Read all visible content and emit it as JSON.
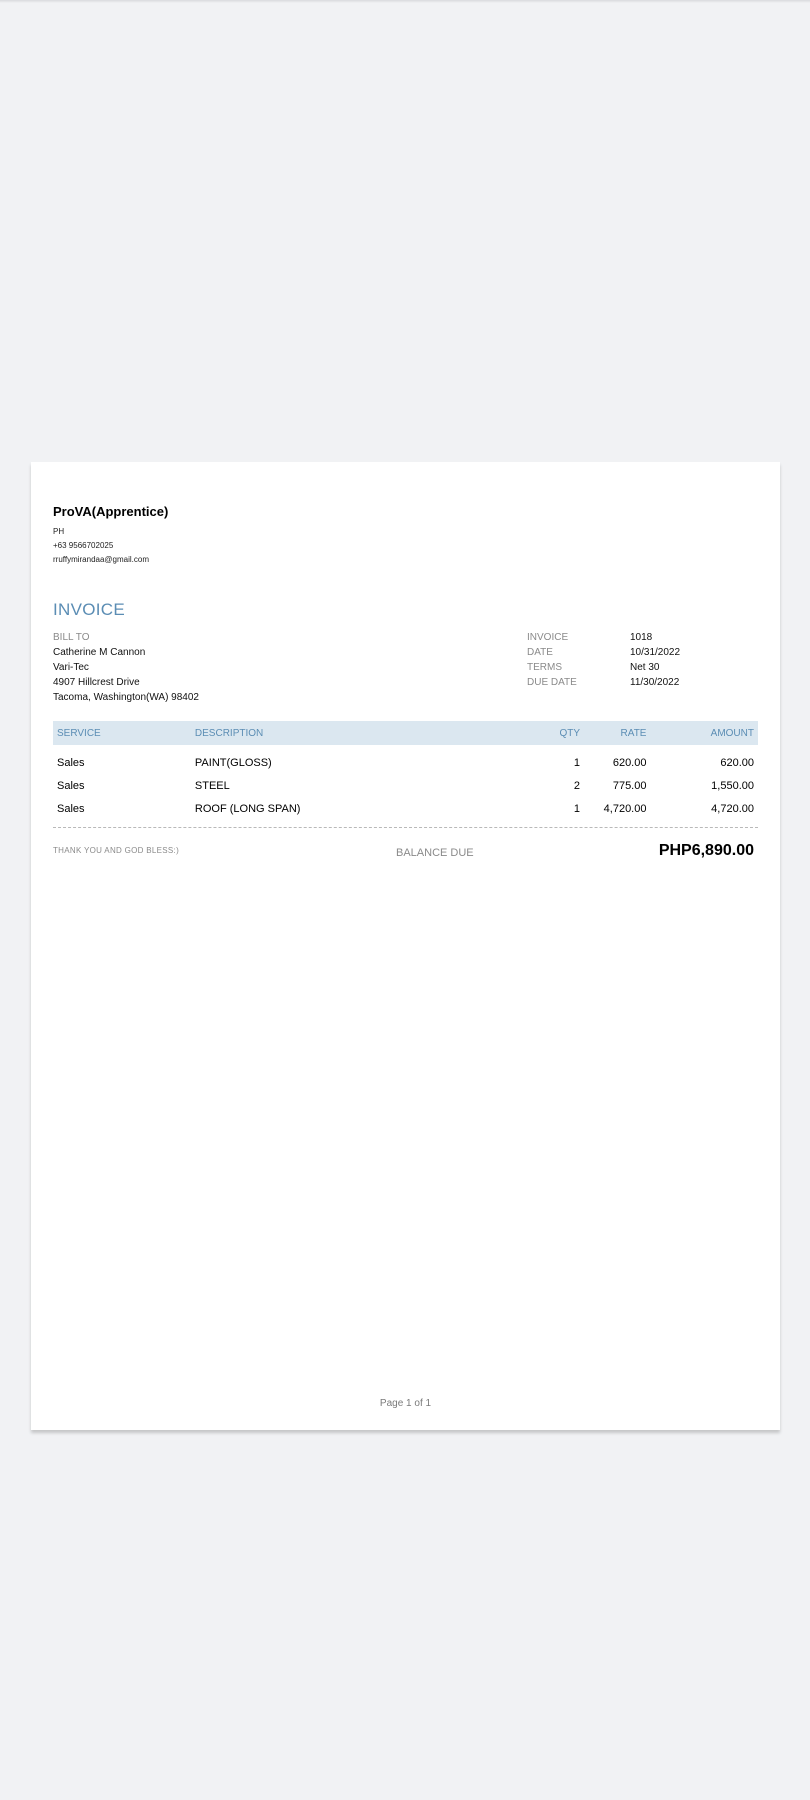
{
  "company": {
    "name": "ProVA(Apprentice)",
    "country": "PH",
    "phone": "+63 9566702025",
    "email": "rruffymirandaa@gmail.com"
  },
  "invoice": {
    "title": "INVOICE",
    "bill_to_label": "BILL TO",
    "bill_to": {
      "name": "Catherine M Cannon",
      "company": "Vari-Tec",
      "address1": "4907 Hillcrest Drive",
      "address2": "Tacoma, Washington(WA)  98402"
    },
    "meta": [
      {
        "key": "INVOICE",
        "value": "1018"
      },
      {
        "key": "DATE",
        "value": "10/31/2022"
      },
      {
        "key": "TERMS",
        "value": "Net 30"
      },
      {
        "key": "DUE DATE",
        "value": "11/30/2022"
      }
    ]
  },
  "table": {
    "headers": {
      "service": "SERVICE",
      "description": "DESCRIPTION",
      "qty": "QTY",
      "rate": "RATE",
      "amount": "AMOUNT"
    },
    "rows": [
      {
        "service": "Sales",
        "description": "PAINT(GLOSS)",
        "qty": "1",
        "rate": "620.00",
        "amount": "620.00"
      },
      {
        "service": "Sales",
        "description": "STEEL",
        "qty": "2",
        "rate": "775.00",
        "amount": "1,550.00"
      },
      {
        "service": "Sales",
        "description": "ROOF (LONG SPAN)",
        "qty": "1",
        "rate": "4,720.00",
        "amount": "4,720.00"
      }
    ]
  },
  "footer": {
    "thank_you": "THANK YOU AND GOD  BLESS:)",
    "balance_label": "BALANCE DUE",
    "balance_value": "PHP6,890.00",
    "page_indicator": "Page 1 of 1"
  },
  "colors": {
    "accent": "#5b8db4",
    "header_bg": "#dbe7f0",
    "page_bg": "#f1f2f4"
  }
}
